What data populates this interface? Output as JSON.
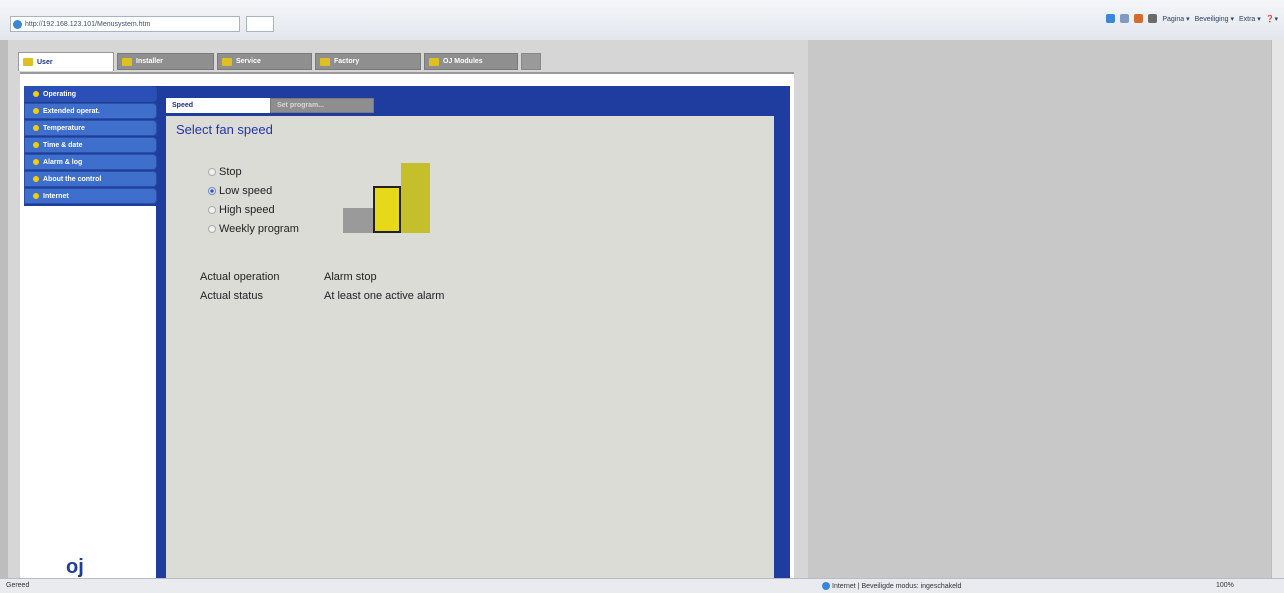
{
  "browser": {
    "address": "http://192.168.123.101/Menusystem.htm",
    "commands": [
      "Pagina ▾",
      "Beveiliging ▾",
      "Extra ▾"
    ],
    "help_label": "❓▾"
  },
  "top_tabs": [
    {
      "label": "User",
      "active": true
    },
    {
      "label": "Installer"
    },
    {
      "label": "Service"
    },
    {
      "label": "Factory"
    },
    {
      "label": "OJ Modules"
    }
  ],
  "side_menu": [
    {
      "label": "Operating",
      "active": true
    },
    {
      "label": "Extended operat."
    },
    {
      "label": "Temperature"
    },
    {
      "label": "Time & date"
    },
    {
      "label": "Alarm & log"
    },
    {
      "label": "About the control"
    },
    {
      "label": "Internet"
    }
  ],
  "content_tabs": [
    {
      "label": "Speed",
      "active": true
    },
    {
      "label": "Set program..."
    }
  ],
  "speed": {
    "title": "Select fan speed",
    "options": [
      {
        "label": "Stop",
        "selected": false
      },
      {
        "label": "Low speed",
        "selected": true
      },
      {
        "label": "High speed",
        "selected": false
      },
      {
        "label": "Weekly program",
        "selected": false
      }
    ],
    "indicator_colors": [
      "#9a9a9a",
      "#e8d81a",
      "#c4bf2a"
    ],
    "actual_operation_label": "Actual operation",
    "actual_operation_value": "Alarm stop",
    "actual_status_label": "Actual status",
    "actual_status_value": "At least one active alarm"
  },
  "logo_text": "oj",
  "statusbar": {
    "left": "Gereed",
    "zone": "Internet | Beveiligde modus: ingeschakeld",
    "zoom": "100%"
  }
}
